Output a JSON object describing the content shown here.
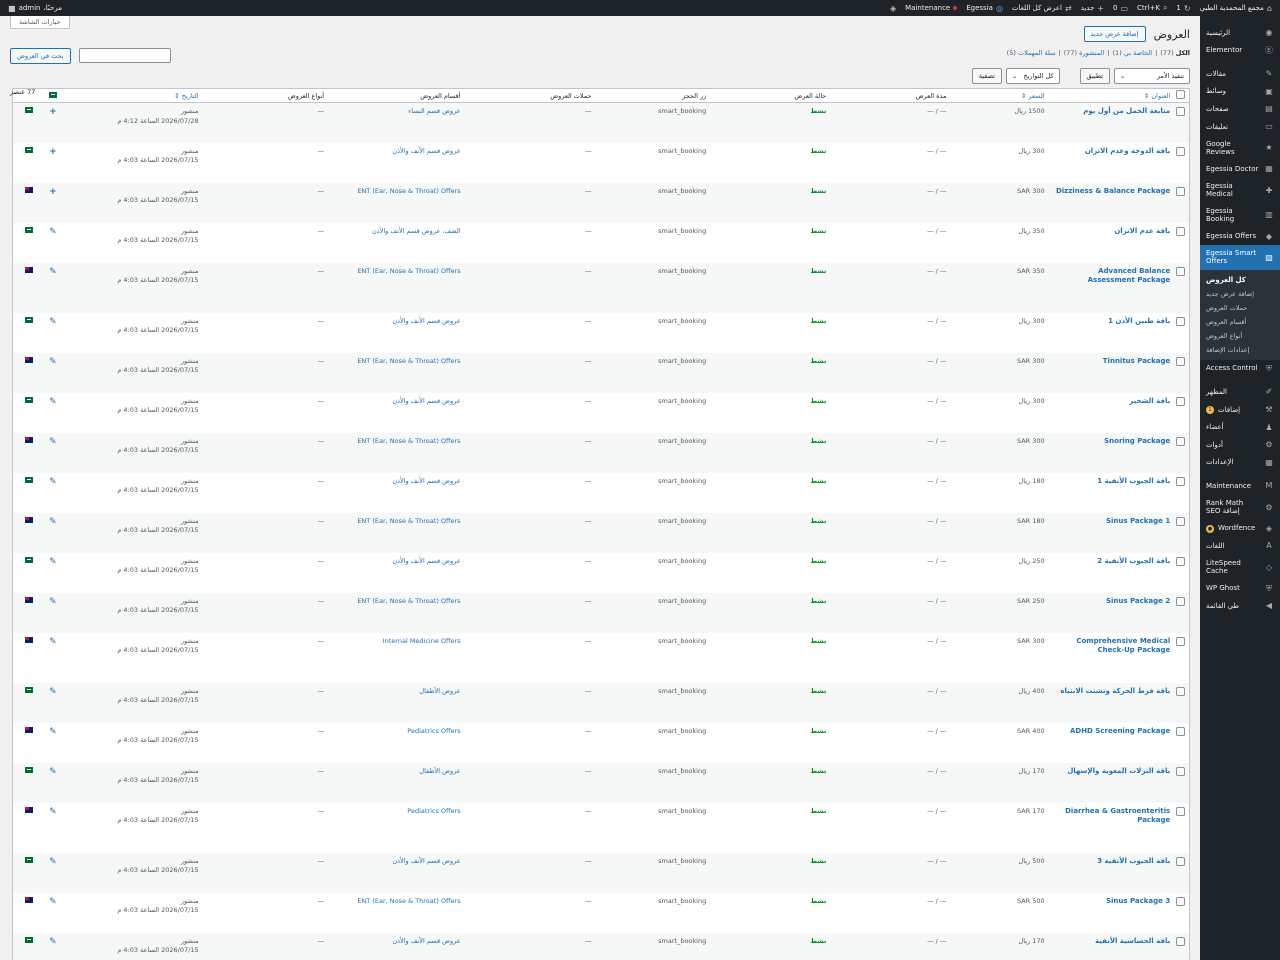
{
  "adminbar": {
    "site_name": "مجمع المحمدية الطبي",
    "updates_count": "1",
    "shortcut": "Ctrl+K",
    "comments_count": "0",
    "new_label": "جديد",
    "view_all_label": "اعرض كل اللغات",
    "egessia_label": "Egessia",
    "maintenance_label": "Maintenance",
    "greeting": "مرحبًا،",
    "user": "admin"
  },
  "sidebar": {
    "items_top": [
      {
        "label": "الرئيسية",
        "icon": "◉"
      },
      {
        "label": "Elementor",
        "icon": "Ⓔ"
      }
    ],
    "items_mid": [
      {
        "label": "مقالات",
        "icon": "✎"
      },
      {
        "label": "وسائط",
        "icon": "▣"
      },
      {
        "label": "صفحات",
        "icon": "▤"
      },
      {
        "label": "تعليقات",
        "icon": "▭"
      },
      {
        "label": "Google Reviews",
        "icon": "★"
      },
      {
        "label": "Egessia Doctor",
        "icon": "▦"
      },
      {
        "label": "Egessia Medical",
        "icon": "✚"
      },
      {
        "label": "Egessia Booking",
        "icon": "▥"
      },
      {
        "label": "Egessia Offers",
        "icon": "◆"
      }
    ],
    "current": {
      "label": "Egessia Smart Offers",
      "icon": "▧"
    },
    "submenu": [
      {
        "label": "كل العروض",
        "active": true
      },
      {
        "label": "إضافة عرض جديد"
      },
      {
        "label": "حملات العروض"
      },
      {
        "label": "أقسام العروض"
      },
      {
        "label": "أنواع العروض"
      },
      {
        "label": "إعدادات الإضافة"
      }
    ],
    "items_after": [
      {
        "label": "Access Control",
        "icon": "⛨"
      }
    ],
    "items_bottom": [
      {
        "label": "المظهر",
        "icon": "✐"
      },
      {
        "label": "إضافات",
        "icon": "⚒",
        "badge": "1"
      },
      {
        "label": "أعضاء",
        "icon": "♟"
      },
      {
        "label": "أدوات",
        "icon": "⚙"
      },
      {
        "label": "الإعدادات",
        "icon": "▦"
      }
    ],
    "items_plugins": [
      {
        "label": "Maintenance",
        "icon": "M"
      },
      {
        "label": "Rank Math إضافة SEO",
        "icon": "⚙"
      },
      {
        "label": "Wordfence",
        "icon": "◈",
        "badge": "●"
      },
      {
        "label": "اللغات",
        "icon": "A"
      },
      {
        "label": "LiteSpeed Cache",
        "icon": "◇"
      },
      {
        "label": "WP Ghost",
        "icon": "⛨"
      },
      {
        "label": "طي القائمة",
        "icon": "◀"
      }
    ]
  },
  "page": {
    "screen_options": "خيارات الشاشة",
    "title": "العروض",
    "add_new": "إضافة عرض جديد",
    "filters": {
      "all": "الكل",
      "all_count": "(77)",
      "mine": "الخاصة بي",
      "mine_count": "(1)",
      "published": "المنشورة",
      "published_count": "(77)",
      "trash": "سلة المهملات",
      "trash_count": "(5)"
    },
    "search_button": "بحث في العروض",
    "bulk_label": "تنفيذ الأمر",
    "apply": "تطبيق",
    "dates_label": "كل التواريخ",
    "filter_button": "تصفية",
    "items_count": "77 عنصر"
  },
  "table": {
    "headers": [
      "العنوان",
      "السعر",
      "مدة العرض",
      "حالة العرض",
      "زر الحجز",
      "حملات العروض",
      "أقسام العروض",
      "أنواع العروض",
      "التاريخ"
    ],
    "rows": [
      {
        "title": "متابعة الحمل من أول يوم",
        "price": "1500 ريال",
        "duration": "— / —",
        "status": "نشط",
        "booking": "smart_booking",
        "campaign": "—",
        "category": "عروض قسم النساء",
        "type": "—",
        "date_status": "منشور",
        "date": "2026/07/28 الساعة 4:12 م",
        "flag": "sa",
        "action": "+"
      },
      {
        "title": "باقة الدوخة وعدم الاتزان",
        "price": "300 ريال",
        "duration": "— / —",
        "status": "نشط",
        "booking": "smart_booking",
        "campaign": "—",
        "category": "عروض قسم الأنف والأذن",
        "type": "—",
        "date_status": "منشور",
        "date": "2026/07/15 الساعة 4:03 م",
        "flag": "sa",
        "action": "+"
      },
      {
        "title": "Dizziness & Balance Package",
        "price": "SAR 300",
        "duration": "— / —",
        "status": "نشط",
        "booking": "smart_booking",
        "campaign": "—",
        "category": "ENT (Ear, Nose & Throat) Offers",
        "type": "—",
        "date_status": "منشور",
        "date": "2026/07/15 الساعة 4:03 م",
        "flag": "au",
        "action": "+"
      },
      {
        "title": "باقة عدم الاتزان",
        "price": "350 ريال",
        "duration": "— / —",
        "status": "نشط",
        "booking": "smart_booking",
        "campaign": "—",
        "category": "الصف، عروض قسم الأنف والأذن",
        "type": "—",
        "date_status": "منشور",
        "date": "2026/07/15 الساعة 4:03 م",
        "flag": "sa",
        "action": "✎"
      },
      {
        "title": "Advanced Balance Assessment Package",
        "price": "SAR 350",
        "duration": "— / —",
        "status": "نشط",
        "booking": "smart_booking",
        "campaign": "—",
        "category": "ENT (Ear, Nose & Throat) Offers",
        "type": "—",
        "date_status": "منشور",
        "date": "2026/07/15 الساعة 4:03 م",
        "flag": "au",
        "action": "✎"
      },
      {
        "title": "باقة طنين الأذن 1",
        "price": "300 ريال",
        "duration": "— / —",
        "status": "نشط",
        "booking": "smart_booking",
        "campaign": "—",
        "category": "عروض قسم الأنف والأذن",
        "type": "—",
        "date_status": "منشور",
        "date": "2026/07/15 الساعة 4:03 م",
        "flag": "sa",
        "action": "✎"
      },
      {
        "title": "Tinnitus Package",
        "price": "SAR 300",
        "duration": "— / —",
        "status": "نشط",
        "booking": "smart_booking",
        "campaign": "—",
        "category": "ENT (Ear, Nose & Throat) Offers",
        "type": "—",
        "date_status": "منشور",
        "date": "2026/07/15 الساعة 4:03 م",
        "flag": "au",
        "action": "✎"
      },
      {
        "title": "باقة الشخير",
        "price": "300 ريال",
        "duration": "— / —",
        "status": "نشط",
        "booking": "smart_booking",
        "campaign": "—",
        "category": "عروض قسم الأنف والأذن",
        "type": "—",
        "date_status": "منشور",
        "date": "2026/07/15 الساعة 4:03 م",
        "flag": "sa",
        "action": "✎"
      },
      {
        "title": "Snoring Package",
        "price": "SAR 300",
        "duration": "— / —",
        "status": "نشط",
        "booking": "smart_booking",
        "campaign": "—",
        "category": "ENT (Ear, Nose & Throat) Offers",
        "type": "—",
        "date_status": "منشور",
        "date": "2026/07/15 الساعة 4:03 م",
        "flag": "au",
        "action": "✎"
      },
      {
        "title": "باقة الجيوب الأنفية 1",
        "price": "180 ريال",
        "duration": "— / —",
        "status": "نشط",
        "booking": "smart_booking",
        "campaign": "—",
        "category": "عروض قسم الأنف والأذن",
        "type": "—",
        "date_status": "منشور",
        "date": "2026/07/15 الساعة 4:03 م",
        "flag": "sa",
        "action": "✎"
      },
      {
        "title": "Sinus Package 1",
        "price": "SAR 180",
        "duration": "— / —",
        "status": "نشط",
        "booking": "smart_booking",
        "campaign": "—",
        "category": "ENT (Ear, Nose & Throat) Offers",
        "type": "—",
        "date_status": "منشور",
        "date": "2026/07/15 الساعة 4:03 م",
        "flag": "au",
        "action": "✎"
      },
      {
        "title": "باقة الجيوب الأنفية 2",
        "price": "250 ريال",
        "duration": "— / —",
        "status": "نشط",
        "booking": "smart_booking",
        "campaign": "—",
        "category": "عروض قسم الأنف والأذن",
        "type": "—",
        "date_status": "منشور",
        "date": "2026/07/15 الساعة 4:03 م",
        "flag": "sa",
        "action": "✎"
      },
      {
        "title": "Sinus Package 2",
        "price": "SAR 250",
        "duration": "— / —",
        "status": "نشط",
        "booking": "smart_booking",
        "campaign": "—",
        "category": "ENT (Ear, Nose & Throat) Offers",
        "type": "—",
        "date_status": "منشور",
        "date": "2026/07/15 الساعة 4:03 م",
        "flag": "au",
        "action": "✎"
      },
      {
        "title": "Comprehensive Medical Check-Up Package",
        "price": "SAR 300",
        "duration": "— / —",
        "status": "نشط",
        "booking": "smart_booking",
        "campaign": "—",
        "category": "Internal Medicine Offers",
        "type": "—",
        "date_status": "منشور",
        "date": "2026/07/15 الساعة 4:03 م",
        "flag": "au",
        "action": "✎"
      },
      {
        "title": "باقة فرط الحركة وتشتت الانتباه",
        "price": "400 ريال",
        "duration": "— / —",
        "status": "نشط",
        "booking": "smart_booking",
        "campaign": "—",
        "category": "عروض الأطفال",
        "type": "—",
        "date_status": "منشور",
        "date": "2026/07/15 الساعة 4:03 م",
        "flag": "sa",
        "action": "✎"
      },
      {
        "title": "ADHD Screening Package",
        "price": "SAR 400",
        "duration": "— / —",
        "status": "نشط",
        "booking": "smart_booking",
        "campaign": "—",
        "category": "Pediatrics Offers",
        "type": "—",
        "date_status": "منشور",
        "date": "2026/07/15 الساعة 4:03 م",
        "flag": "au",
        "action": "✎"
      },
      {
        "title": "باقة النزلات المعوية والإسهال",
        "price": "170 ريال",
        "duration": "— / —",
        "status": "نشط",
        "booking": "smart_booking",
        "campaign": "—",
        "category": "عروض الأطفال",
        "type": "—",
        "date_status": "منشور",
        "date": "2026/07/15 الساعة 4:03 م",
        "flag": "sa",
        "action": "✎"
      },
      {
        "title": "Diarrhea & Gastroenteritis Package",
        "price": "SAR 170",
        "duration": "— / —",
        "status": "نشط",
        "booking": "smart_booking",
        "campaign": "—",
        "category": "Pediatrics Offers",
        "type": "—",
        "date_status": "منشور",
        "date": "2026/07/15 الساعة 4:03 م",
        "flag": "au",
        "action": "✎"
      },
      {
        "title": "باقة الجيوب الأنفية 3",
        "price": "500 ريال",
        "duration": "— / —",
        "status": "نشط",
        "booking": "smart_booking",
        "campaign": "—",
        "category": "عروض قسم الأنف والأذن",
        "type": "—",
        "date_status": "منشور",
        "date": "2026/07/15 الساعة 4:03 م",
        "flag": "sa",
        "action": "✎"
      },
      {
        "title": "Sinus Package 3",
        "price": "SAR 500",
        "duration": "— / —",
        "status": "نشط",
        "booking": "smart_booking",
        "campaign": "—",
        "category": "ENT (Ear, Nose & Throat) Offers",
        "type": "—",
        "date_status": "منشور",
        "date": "2026/07/15 الساعة 4:03 م",
        "flag": "au",
        "action": "✎"
      },
      {
        "title": "باقة الحساسية الأنفية",
        "price": "170 ريال",
        "duration": "— / —",
        "status": "نشط",
        "booking": "smart_booking",
        "campaign": "—",
        "category": "عروض قسم الأنف والأذن",
        "type": "—",
        "date_status": "منشور",
        "date": "2026/07/15 الساعة 4:03 م",
        "flag": "sa",
        "action": "✎"
      }
    ]
  }
}
